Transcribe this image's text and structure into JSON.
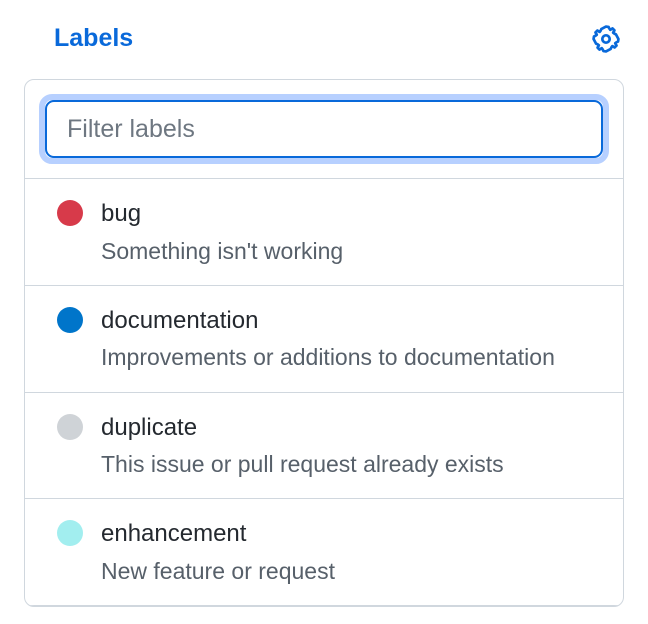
{
  "header": {
    "title": "Labels"
  },
  "filter": {
    "placeholder": "Filter labels",
    "value": ""
  },
  "labels": [
    {
      "name": "bug",
      "description": "Something isn't working",
      "color": "#d73a4a"
    },
    {
      "name": "documentation",
      "description": "Improvements or additions to documentation",
      "color": "#0075ca"
    },
    {
      "name": "duplicate",
      "description": "This issue or pull request already exists",
      "color": "#cfd3d7"
    },
    {
      "name": "enhancement",
      "description": "New feature or request",
      "color": "#a2eeef"
    }
  ]
}
